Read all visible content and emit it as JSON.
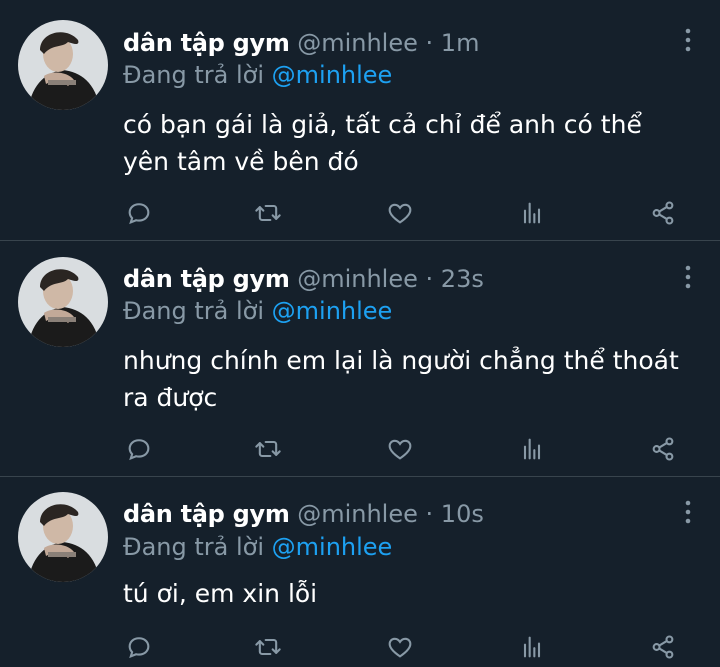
{
  "colors": {
    "background": "#15202b",
    "divider": "#38444d",
    "muted": "#8899a6",
    "link": "#1da1f2",
    "text": "#ffffff"
  },
  "tweets": [
    {
      "display_name": "dân tập gym",
      "handle": "@minhlee",
      "separator": "·",
      "time": "1m",
      "reply_prefix": "Đang trả lời",
      "reply_to": "@minhlee",
      "text": "có bạn gái là giả, tất cả chỉ để anh có thể yên tâm về bên đó"
    },
    {
      "display_name": "dân tập gym",
      "handle": "@minhlee",
      "separator": "·",
      "time": "23s",
      "reply_prefix": "Đang trả lời",
      "reply_to": "@minhlee",
      "text": "nhưng chính em lại là người chẳng thể thoát ra được"
    },
    {
      "display_name": "dân tập gym",
      "handle": "@minhlee",
      "separator": "·",
      "time": "10s",
      "reply_prefix": "Đang trả lời",
      "reply_to": "@minhlee",
      "text": "tú ơi, em xin lỗi"
    }
  ],
  "icons": {
    "more": "more-vertical-icon",
    "reply": "reply-icon",
    "retweet": "retweet-icon",
    "like": "heart-icon",
    "stats": "analytics-icon",
    "share": "share-icon"
  }
}
